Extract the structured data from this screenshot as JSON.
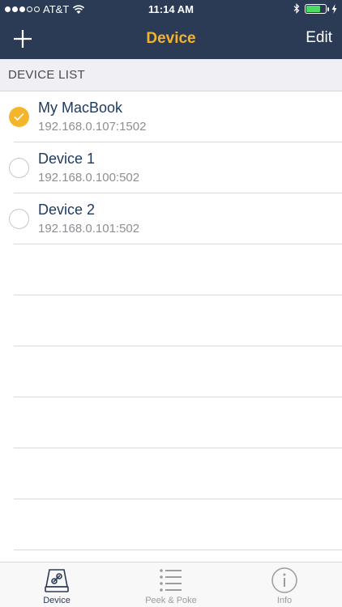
{
  "status_bar": {
    "carrier": "AT&T",
    "time": "11:14 AM",
    "signal_bars": 3,
    "battery_level": 0.75,
    "battery_color": "#4cd964"
  },
  "navbar": {
    "title": "Device",
    "add_icon": "plus-icon",
    "edit_label": "Edit",
    "title_color": "#f4b42a",
    "background": "#2b3a55"
  },
  "section": {
    "header": "DEVICE LIST"
  },
  "devices": [
    {
      "name": "My MacBook",
      "address": "192.168.0.107:1502",
      "selected": true
    },
    {
      "name": "Device 1",
      "address": "192.168.0.100:502",
      "selected": false
    },
    {
      "name": "Device 2",
      "address": "192.168.0.101:502",
      "selected": false
    }
  ],
  "tabs": [
    {
      "label": "Device",
      "icon": "device-link-icon",
      "active": true
    },
    {
      "label": "Peek & Poke",
      "icon": "list-icon",
      "active": false
    },
    {
      "label": "Info",
      "icon": "info-icon",
      "active": false
    }
  ]
}
